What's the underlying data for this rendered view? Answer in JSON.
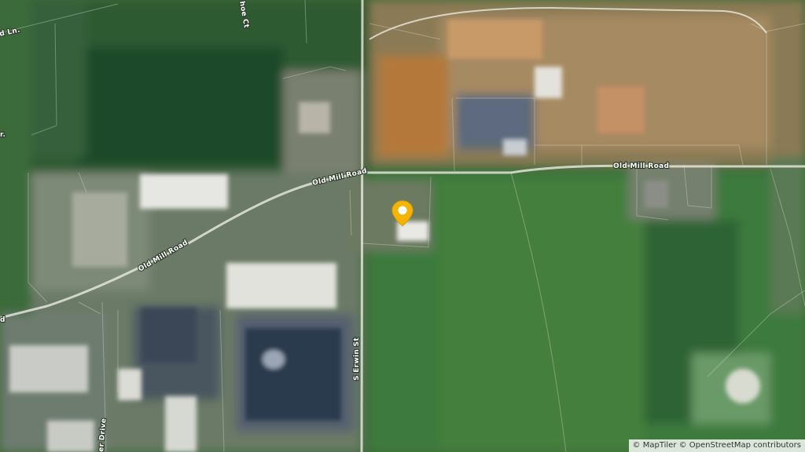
{
  "map": {
    "style": "satellite",
    "marker_color": "#f5b400",
    "roads": {
      "old_mill_road_1": "Old Mill Road",
      "old_mill_road_2": "Old Mill Road",
      "old_mill_road_3": "Old Mill Road",
      "s_erwin_st": "S Erwin St",
      "partial_ln": "d Ln.",
      "partial_ct": "hoe Ct",
      "partial_dr": "r.",
      "partial_drive": "er Drive",
      "partial_road_left": "d"
    },
    "marker_icon": "location-pin-icon"
  },
  "attribution": {
    "text": "© MapTiler © OpenStreetMap contributors"
  }
}
